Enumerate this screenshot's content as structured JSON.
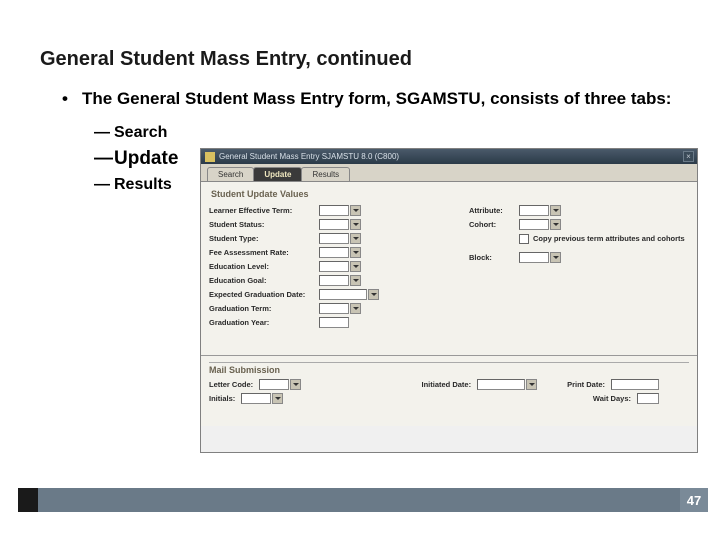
{
  "slide": {
    "title": "General Student Mass Entry, continued",
    "bullet": "The General Student Mass Entry form, SGAMSTU, consists of three tabs:",
    "subs": [
      {
        "dash": "—",
        "label": "Search"
      },
      {
        "dash": "—",
        "label": "Update"
      },
      {
        "dash": "—",
        "label": "Results"
      }
    ]
  },
  "page_number": "47",
  "app": {
    "window_title": "General Student Mass Entry  SJAMSTU  8.0  (C800)",
    "tabs": [
      {
        "label": "Search",
        "active": false
      },
      {
        "label": "Update",
        "active": true
      },
      {
        "label": "Results",
        "active": false
      }
    ],
    "section_title": "Student Update Values",
    "left_fields": [
      "Learner Effective Term:",
      "Student Status:",
      "Student Type:",
      "Fee Assessment Rate:",
      "Education Level:",
      "Education Goal:",
      "Expected Graduation Date:",
      "Graduation Term:",
      "Graduation Year:"
    ],
    "right_fields": {
      "attribute": "Attribute:",
      "cohort": "Cohort:",
      "copy_prev": "Copy previous term attributes and cohorts",
      "block": "Block:"
    },
    "mail": {
      "title": "Mail Submission",
      "letter_code": "Letter Code:",
      "initials": "Initials:",
      "initiated_date": "Initiated Date:",
      "print_date": "Print Date:",
      "wait_days": "Wait Days:"
    }
  }
}
